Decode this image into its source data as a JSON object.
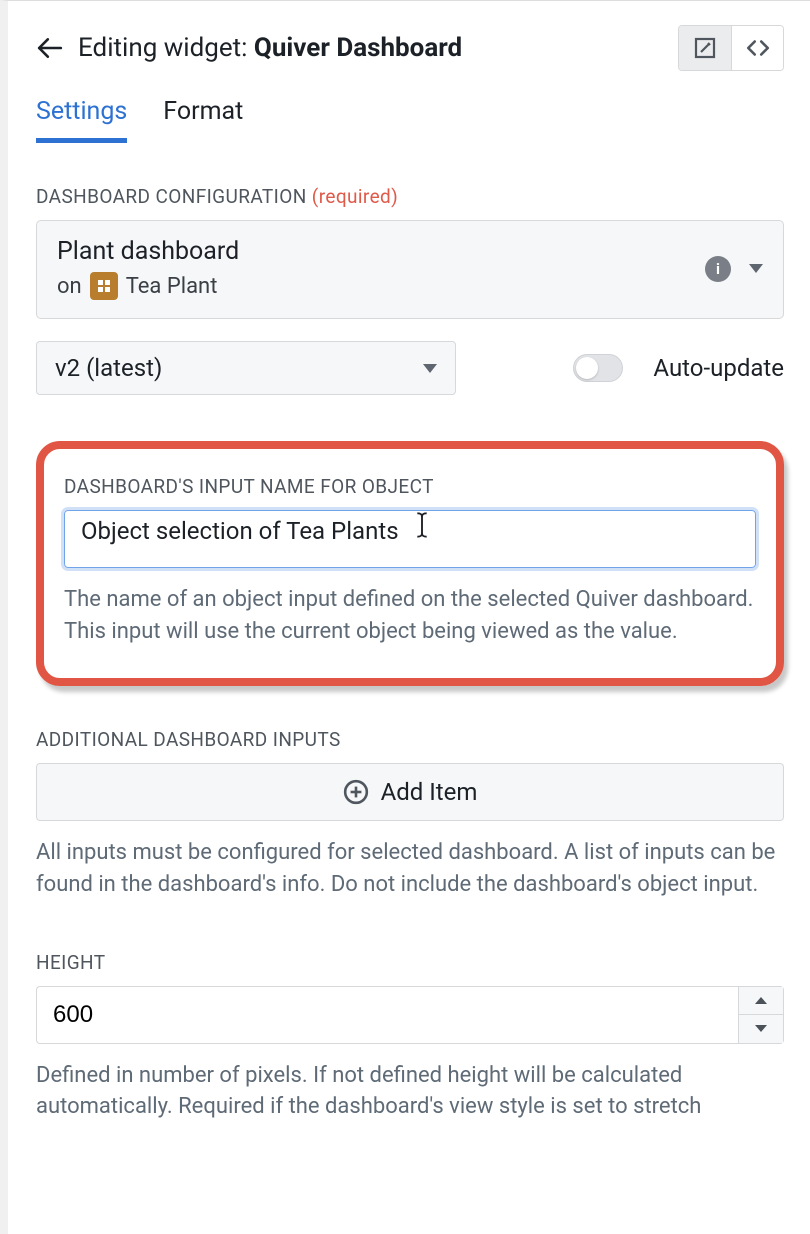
{
  "header": {
    "prefix": "Editing widget: ",
    "name": "Quiver Dashboard"
  },
  "tabs": {
    "settings": "Settings",
    "format": "Format"
  },
  "dashboard_config": {
    "label": "DASHBOARD CONFIGURATION",
    "required": " (required)",
    "title": "Plant dashboard",
    "on_prefix": "on",
    "entity": "Tea Plant"
  },
  "version": {
    "value": "v2 (latest)"
  },
  "auto_update": {
    "label": "Auto-update"
  },
  "input_name": {
    "label": "DASHBOARD'S INPUT NAME FOR OBJECT",
    "value": "Object selection of Tea Plants",
    "help": "The name of an object input defined on the selected Quiver dashboard. This input will use the current object being viewed as the value."
  },
  "additional_inputs": {
    "label": "ADDITIONAL DASHBOARD INPUTS",
    "add_label": "Add Item",
    "help": "All inputs must be configured for selected dashboard. A list of inputs can be found in the dashboard's info. Do not include the dashboard's object input."
  },
  "height": {
    "label": "HEIGHT",
    "value": "600",
    "help": "Defined in number of pixels. If not defined height will be calculated automatically. Required if the dashboard's view style is set to stretch"
  }
}
